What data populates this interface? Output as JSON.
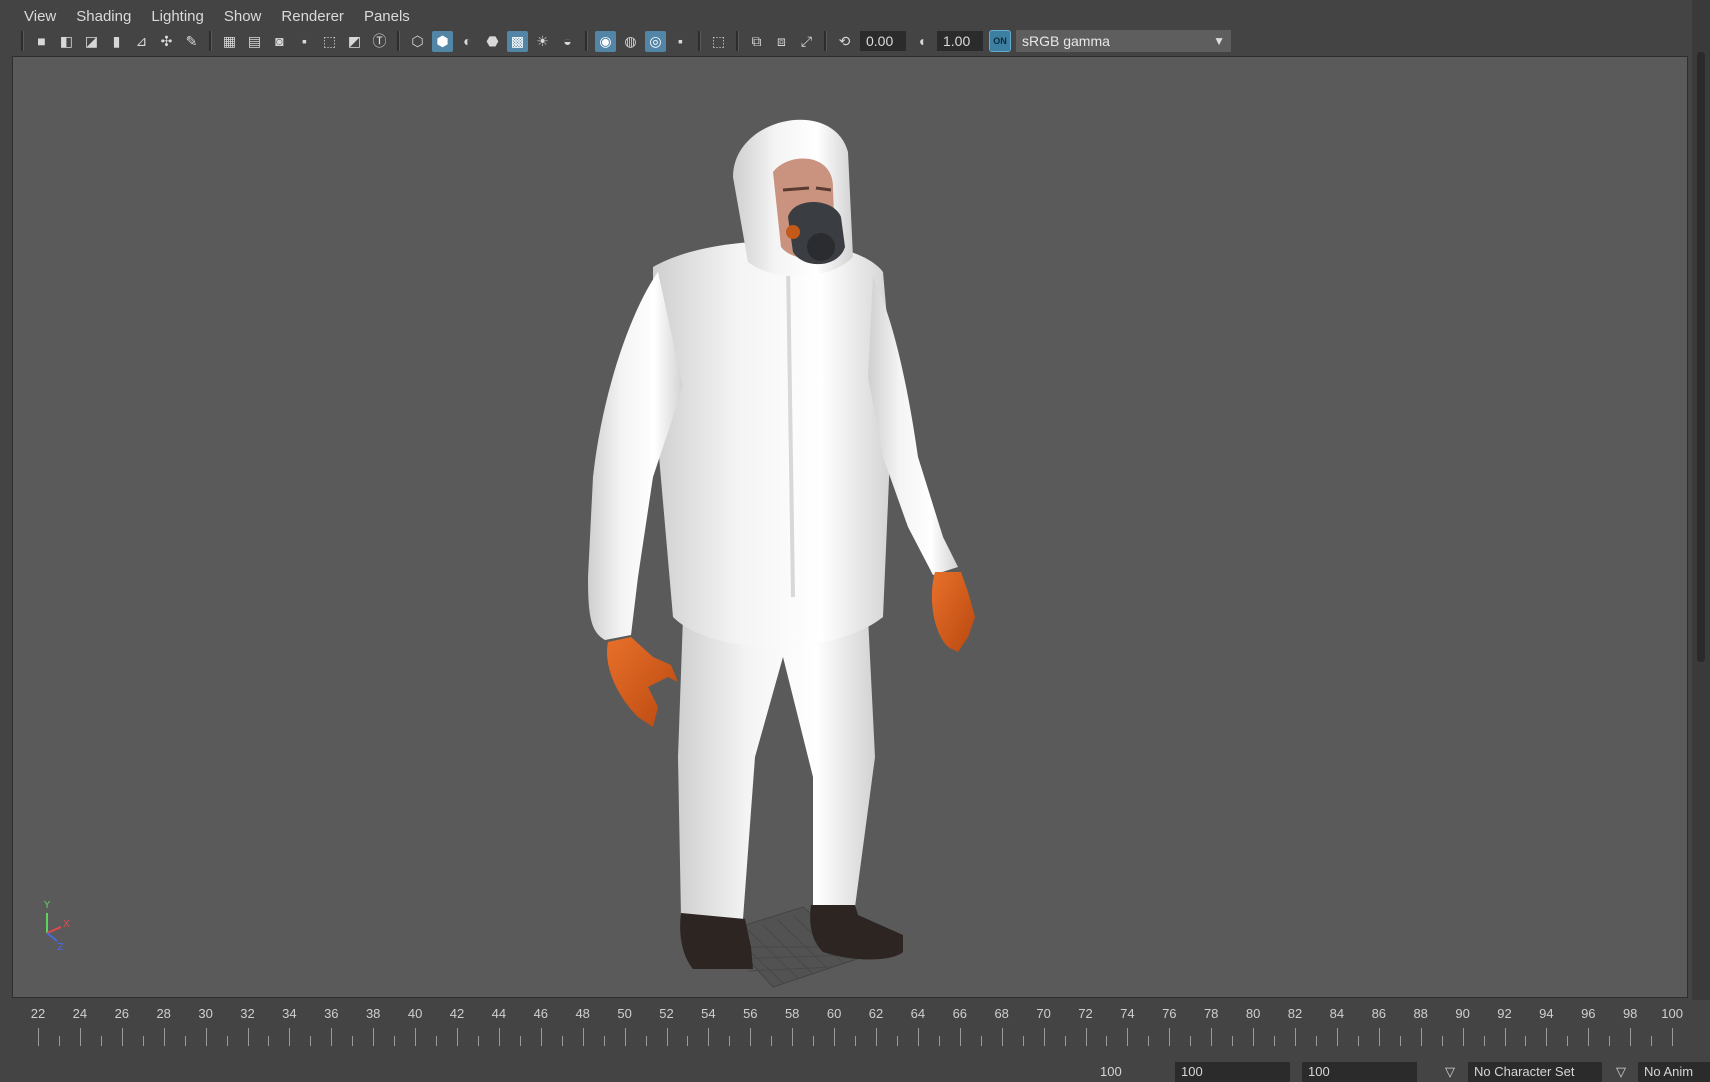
{
  "menubar": {
    "items": [
      "View",
      "Shading",
      "Lighting",
      "Show",
      "Renderer",
      "Panels"
    ]
  },
  "toolbar": {
    "exposure_value": "0.00",
    "gamma_value": "1.00",
    "color_management_toggle": "ON",
    "color_space": "sRGB gamma",
    "icons": [
      "camera-icon",
      "camera-attributes-icon",
      "bookmark-icon",
      "image-plane-icon",
      "2d-pan-zoom-icon",
      "grease-pencil-icon",
      "grid-icon",
      "film-gate-icon",
      "resolution-gate-icon",
      "field-chart-icon",
      "safe-action-icon",
      "safe-title-icon",
      "wireframe-icon",
      "smooth-shade-icon",
      "default-material-icon",
      "wireframe-on-shaded-icon",
      "x-ray-icon",
      "use-all-lights-icon",
      "shadows-icon",
      "screen-space-ao-icon",
      "motion-blur-icon",
      "anti-aliasing-icon",
      "depth-of-field-icon",
      "isolate-select-icon",
      "xray-joints-icon",
      "xray-active-icon",
      "camera-sequencer-icon",
      "exposure-icon",
      "gamma-icon"
    ]
  },
  "viewport": {
    "axis_labels": {
      "y": "Y",
      "x": "X",
      "z": "Z"
    }
  },
  "timeline": {
    "tick_labels": [
      "22",
      "24",
      "26",
      "28",
      "30",
      "32",
      "34",
      "36",
      "38",
      "40",
      "42",
      "44",
      "46",
      "48",
      "50",
      "52",
      "54",
      "56",
      "58",
      "60",
      "62",
      "64",
      "66",
      "68",
      "70",
      "72",
      "74",
      "76",
      "78",
      "80",
      "82",
      "84",
      "86",
      "88",
      "90",
      "92",
      "94",
      "96",
      "98",
      "100"
    ]
  },
  "rangebar": {
    "end_value": "100",
    "field_a": "100",
    "field_b": "100",
    "character_set": "No Character Set",
    "anim_layer": "No Anim"
  },
  "colors": {
    "viewport_bg": "#5a5a5a",
    "ui_bg": "#444444",
    "active_blue": "#5285a6"
  }
}
